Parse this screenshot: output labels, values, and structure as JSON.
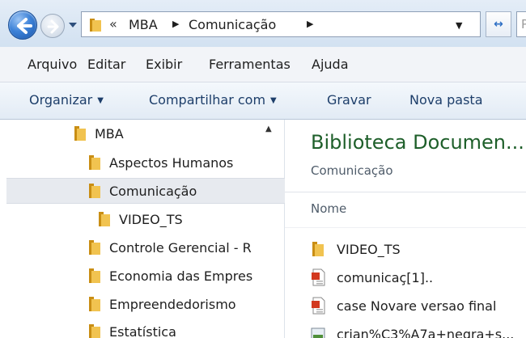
{
  "address": {
    "chevrons": "«",
    "crumbs": [
      "MBA",
      "Comunicação"
    ],
    "sep": "▶",
    "dropdown": "▼",
    "refresh": "↔",
    "search_placeholder": "P"
  },
  "menu": [
    "Arquivo",
    "Editar",
    "Exibir",
    "Ferramentas",
    "Ajuda"
  ],
  "toolbar": {
    "organize": "Organizar",
    "share": "Compartilhar com",
    "burn": "Gravar",
    "new_folder": "Nova pasta",
    "caret": "▼"
  },
  "nav": {
    "scroll_up": "▲",
    "items": [
      {
        "label": "MBA"
      },
      {
        "label": "Aspectos Humanos"
      },
      {
        "label": "Comunicação"
      },
      {
        "label": "VIDEO_TS"
      },
      {
        "label": "Controle Gerencial - R"
      },
      {
        "label": "Economia das Empres"
      },
      {
        "label": "Empreendedorismo"
      },
      {
        "label": "Estatística"
      }
    ]
  },
  "content": {
    "title": "Biblioteca Documen...",
    "subtitle": "Comunicação",
    "column": "Nome",
    "files": [
      {
        "label": "VIDEO_TS",
        "icon": "folder-icon"
      },
      {
        "label": "comunicaç[1]..",
        "icon": "powerpoint-file-icon"
      },
      {
        "label": "case Novare versao final",
        "icon": "powerpoint-file-icon"
      },
      {
        "label": "crian%C3%A7a+negra+s...",
        "icon": "image-file-icon"
      }
    ]
  },
  "colors": {
    "folder": "#e9b73a",
    "title_green": "#1e5f2a",
    "link_blue": "#1d3e6a"
  }
}
